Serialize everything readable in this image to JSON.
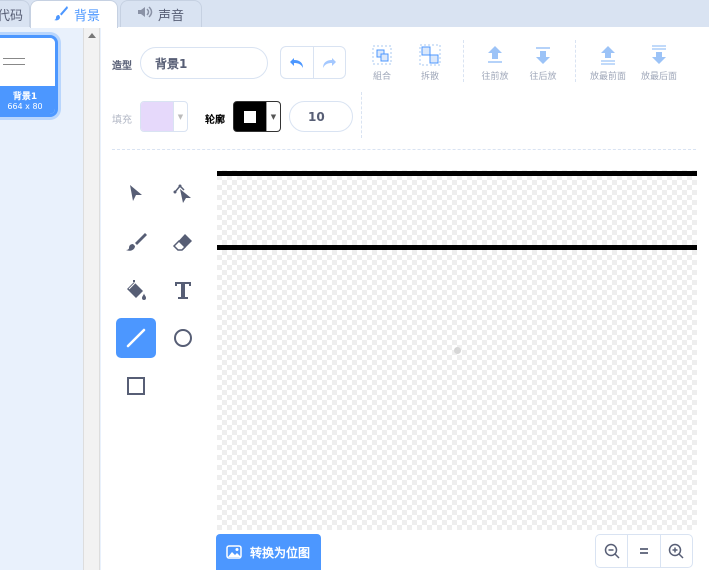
{
  "tabs": {
    "code": "代码",
    "backdrop": "背景",
    "sound": "声音"
  },
  "costume_list": {
    "items": [
      {
        "name": "背景1",
        "size": "664 x 80",
        "selected": true
      }
    ]
  },
  "editor": {
    "name_label": "造型",
    "name_value": "背景1",
    "toolbar": {
      "group": "組合",
      "ungroup": "拆散",
      "forward": "往前放",
      "backward": "往后放",
      "front": "放最前面",
      "back": "放最后面"
    },
    "fill_label": "填充",
    "outline_label": "轮廓",
    "outline_width": "10",
    "fill_color": "#e6d9fb",
    "outline_color": "#000000"
  },
  "tools": [
    "select",
    "reshape",
    "brush",
    "eraser",
    "fill",
    "text",
    "line",
    "circle",
    "rectangle"
  ],
  "active_tool": "line",
  "convert_button": "转换为位图",
  "accent_color": "#4c97ff"
}
